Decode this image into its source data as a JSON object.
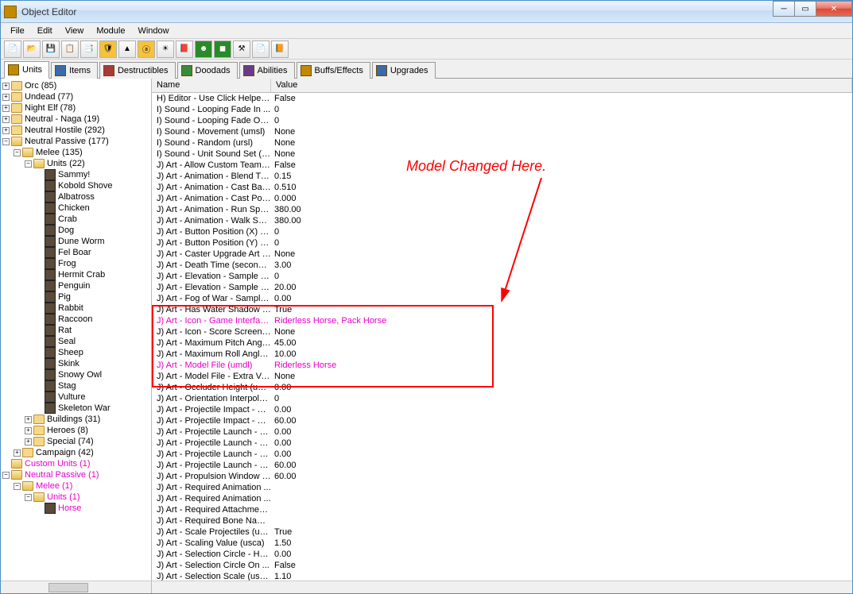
{
  "window": {
    "title": "Object Editor"
  },
  "menu": {
    "file": "File",
    "edit": "Edit",
    "view": "View",
    "module": "Module",
    "window": "Window"
  },
  "tabs": {
    "units": "Units",
    "items": "Items",
    "destructibles": "Destructibles",
    "doodads": "Doodads",
    "abilities": "Abilities",
    "buffs": "Buffs/Effects",
    "upgrades": "Upgrades"
  },
  "cols": {
    "name": "Name",
    "value": "Value"
  },
  "tree": {
    "orc": "Orc (85)",
    "undead": "Undead (77)",
    "nightelf": "Night Elf (78)",
    "naga": "Neutral - Naga (19)",
    "hostile": "Neutral Hostile (292)",
    "passive": "Neutral Passive (177)",
    "melee": "Melee (135)",
    "units22": "Units (22)",
    "u": {
      "sammy": "Sammy!",
      "kobold": "Kobold Shove",
      "alb": "Albatross",
      "chick": "Chicken",
      "crab": "Crab",
      "dog": "Dog",
      "dune": "Dune Worm",
      "felboar": "Fel Boar",
      "frog": "Frog",
      "hermit": "Hermit Crab",
      "penguin": "Penguin",
      "pig": "Pig",
      "rabbit": "Rabbit",
      "raccoon": "Raccoon",
      "rat": "Rat",
      "seal": "Seal",
      "sheep": "Sheep",
      "skink": "Skink",
      "snowy": "Snowy Owl",
      "stag": "Stag",
      "vulture": "Vulture",
      "skel": "Skeleton War"
    },
    "buildings": "Buildings (31)",
    "heroes": "Heroes (8)",
    "special": "Special (74)",
    "campaign": "Campaign (42)",
    "custom": "Custom Units (1)",
    "cpassive": "Neutral Passive (1)",
    "cmelee": "Melee (1)",
    "cunits": "Units (1)",
    "horse": "Horse"
  },
  "props": [
    {
      "n": "H) Editor - Use Click Helper (...",
      "v": "False"
    },
    {
      "n": "I) Sound - Looping Fade In ...",
      "v": "0"
    },
    {
      "n": "I) Sound - Looping Fade Out...",
      "v": "0"
    },
    {
      "n": "I) Sound - Movement (umsl)",
      "v": "None"
    },
    {
      "n": "I) Sound - Random (ursl)",
      "v": "None"
    },
    {
      "n": "I) Sound - Unit Sound Set (u...",
      "v": "None"
    },
    {
      "n": "J) Art - Allow Custom Team ...",
      "v": "False"
    },
    {
      "n": "J) Art - Animation - Blend Tim...",
      "v": "0.15"
    },
    {
      "n": "J) Art - Animation - Cast Bac...",
      "v": "0.510"
    },
    {
      "n": "J) Art - Animation - Cast Poin...",
      "v": "0.000"
    },
    {
      "n": "J) Art - Animation - Run Spe...",
      "v": "380.00"
    },
    {
      "n": "J) Art - Animation - Walk Spe...",
      "v": "380.00"
    },
    {
      "n": "J) Art - Button Position (X) (u...",
      "v": "0"
    },
    {
      "n": "J) Art - Button Position (Y) (u...",
      "v": "0"
    },
    {
      "n": "J) Art - Caster Upgrade Art (u...",
      "v": "None"
    },
    {
      "n": "J) Art - Death Time (seconds...",
      "v": "3.00"
    },
    {
      "n": "J) Art - Elevation - Sample P...",
      "v": "0"
    },
    {
      "n": "J) Art - Elevation - Sample R...",
      "v": "20.00"
    },
    {
      "n": "J) Art - Fog of War - Sample ...",
      "v": "0.00"
    },
    {
      "n": "J) Art - Has Water Shadow (...",
      "v": "True"
    },
    {
      "n": "J) Art - Icon - Game Interfac...",
      "v": "Riderless Horse, Pack Horse",
      "pink": true
    },
    {
      "n": "J) Art - Icon - Score Screen (...",
      "v": "None"
    },
    {
      "n": "J) Art - Maximum Pitch Angle...",
      "v": "45.00"
    },
    {
      "n": "J) Art - Maximum Roll Angle (...",
      "v": "10.00"
    },
    {
      "n": "J) Art - Model File (umdl)",
      "v": "Riderless Horse",
      "pink": true
    },
    {
      "n": "J) Art - Model File - Extra Ver...",
      "v": "None"
    },
    {
      "n": "J) Art - Occluder Height (uocc)",
      "v": "0.00"
    },
    {
      "n": "J) Art - Orientation Interpolati...",
      "v": "0"
    },
    {
      "n": "J) Art - Projectile Impact - Z (...",
      "v": "0.00"
    },
    {
      "n": "J) Art - Projectile Impact - Z (...",
      "v": "60.00"
    },
    {
      "n": "J) Art - Projectile Launch - X ...",
      "v": "0.00"
    },
    {
      "n": "J) Art - Projectile Launch - Y ...",
      "v": "0.00"
    },
    {
      "n": "J) Art - Projectile Launch - Z ...",
      "v": "0.00"
    },
    {
      "n": "J) Art - Projectile Launch - Z ...",
      "v": "60.00"
    },
    {
      "n": "J) Art - Propulsion Window (...",
      "v": "60.00"
    },
    {
      "n": "J) Art - Required Animation ...",
      "v": ""
    },
    {
      "n": "J) Art - Required Animation ...",
      "v": ""
    },
    {
      "n": "J) Art - Required Attachment...",
      "v": ""
    },
    {
      "n": "J) Art - Required Bone Name...",
      "v": ""
    },
    {
      "n": "J) Art - Scale Projectiles (uscb)",
      "v": "True"
    },
    {
      "n": "J) Art - Scaling Value (usca)",
      "v": "1.50"
    },
    {
      "n": "J) Art - Selection Circle - Hei...",
      "v": "0.00"
    },
    {
      "n": "J) Art - Selection Circle On ...",
      "v": "False"
    },
    {
      "n": "J) Art - Selection Scale (ussc)",
      "v": "1.10"
    }
  ],
  "annotation": "Model Changed Here."
}
